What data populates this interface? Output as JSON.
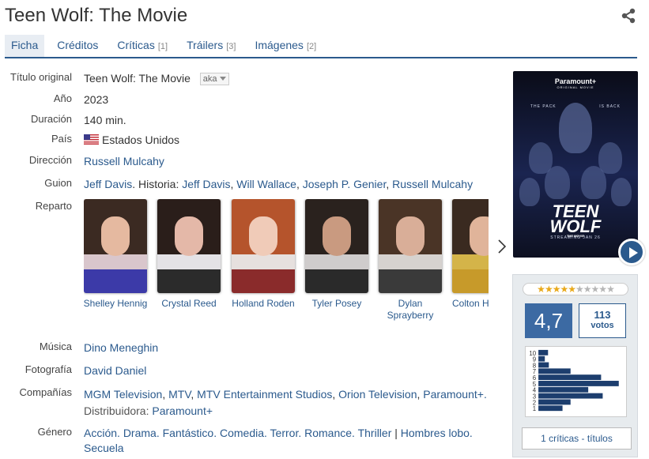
{
  "title": "Teen Wolf: The Movie",
  "tabs": [
    {
      "label": "Ficha",
      "count": ""
    },
    {
      "label": "Créditos",
      "count": ""
    },
    {
      "label": "Críticas",
      "count": "[1]"
    },
    {
      "label": "Tráilers",
      "count": "[3]"
    },
    {
      "label": "Imágenes",
      "count": "[2]"
    }
  ],
  "info": {
    "titulo_label": "Título original",
    "titulo": "Teen Wolf: The Movie",
    "aka": "aka",
    "anio_label": "Año",
    "anio": "2023",
    "duracion_label": "Duración",
    "duracion": "140 min.",
    "pais_label": "País",
    "pais": "Estados Unidos",
    "direccion_label": "Dirección",
    "direccion": "Russell Mulcahy",
    "guion_label": "Guion",
    "guion": [
      "Jeff Davis",
      "Historia:",
      "Jeff Davis",
      "Will Wallace",
      "Joseph P. Genier",
      "Russell Mulcahy"
    ],
    "reparto_label": "Reparto",
    "musica_label": "Música",
    "musica": "Dino Meneghin",
    "fotografia_label": "Fotografía",
    "fotografia": "David Daniel",
    "companias_label": "Compañías",
    "companias": [
      "MGM Television",
      "MTV",
      "MTV Entertainment Studios",
      "Orion Television",
      "Paramount+."
    ],
    "distribuidora_label": "Distribuidora:",
    "distribuidora": "Paramount+",
    "genero_label": "Género",
    "generos": [
      "Acción.",
      "Drama.",
      "Fantástico.",
      "Comedia.",
      "Terror.",
      "Romance.",
      "Thriller"
    ],
    "generos_extra": [
      "Hombres lobo.",
      "Secuela"
    ]
  },
  "cast": [
    {
      "name": "Shelley Hennig"
    },
    {
      "name": "Crystal Reed"
    },
    {
      "name": "Holland Roden"
    },
    {
      "name": "Tyler Posey"
    },
    {
      "name": "Dylan Sprayberry"
    },
    {
      "name": "Colton H"
    }
  ],
  "poster": {
    "brand": "Paramount+",
    "sub_brand": "ORIGINAL MOVIE",
    "tagline_left": "THE PACK",
    "tagline_right": "IS BACK",
    "title_line1": "TEEN",
    "title_line2": "WOLF",
    "subtitle": "THE MOVIE",
    "streaming": "STREAMING JAN 26"
  },
  "rating": {
    "stars_on": 5,
    "stars_total": 10,
    "average": "4,7",
    "votes": "113",
    "votes_label": "votos",
    "histogram": [
      {
        "score": "10",
        "share": 0.12
      },
      {
        "score": "9",
        "share": 0.08
      },
      {
        "score": "8",
        "share": 0.13
      },
      {
        "score": "7",
        "share": 0.4
      },
      {
        "score": "6",
        "share": 0.78
      },
      {
        "score": "5",
        "share": 1.0
      },
      {
        "score": "4",
        "share": 0.62
      },
      {
        "score": "3",
        "share": 0.8
      },
      {
        "score": "2",
        "share": 0.4
      },
      {
        "score": "1",
        "share": 0.3
      }
    ],
    "critics_label": "1 críticas - títulos"
  },
  "colors": {
    "link": "#2b5a8d",
    "accent": "#3c6aa3",
    "star": "#e9a91b"
  }
}
